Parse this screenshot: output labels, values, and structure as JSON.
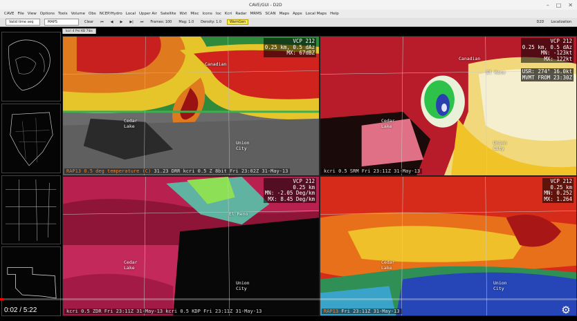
{
  "window": {
    "title": "CAVE/GUI - D2D"
  },
  "menubar": [
    "CAVE",
    "File",
    "View",
    "Options",
    "Tools",
    "Volume",
    "Obs",
    "NCEP/Hydro",
    "Local",
    "Upper Air",
    "Satellite",
    "Wxt",
    "Misc",
    "Icons",
    "Ioc",
    "Kcri",
    "Radar",
    "MRMS",
    "SCAN",
    "Maps",
    "Apps",
    "Local Maps",
    "Help"
  ],
  "toolbar": {
    "time_select": "Valid time seq",
    "proj": "MAPS",
    "clear": "Clear",
    "frames": "Frames: 100",
    "mag": "Mag: 1.0",
    "density": "Density: 1.0",
    "highlight": "WarnGen",
    "mode": "D2D",
    "localization": "Localization"
  },
  "tabs": [
    "kcri 4 Pnl KB 7lbs"
  ],
  "panels": [
    {
      "readout": [
        "VCP 212",
        "0.25 km, 0.5 dAz",
        "MX: 67dBZ"
      ],
      "extra": [],
      "status_prefix": "RAP13 0.5 deg temperature (C)",
      "status": "31.23  DRR  kcri 0.5  Z 8bit  Fri 23:02Z 31-May-13",
      "cities": {
        "a": "Canadian",
        "b": "Cedar\nLake",
        "c": "Union\nCity",
        "d": ""
      }
    },
    {
      "readout": [
        "VCP 212",
        "0.25 km, 0.5 dAz",
        "MN: -123kt",
        "MX: 122kt"
      ],
      "extra": [
        "USR:  274°  16.0kt",
        "MVMT FROM 23:30Z"
      ],
      "status_prefix": "",
      "status": "kcri 0.5  SRM  Fri 23:11Z 31-May-13",
      "cities": {
        "a": "Canadian",
        "b": "Cedar\nLake",
        "c": "Union\nCity",
        "d": "El Reno"
      }
    },
    {
      "readout": [
        "VCP 212",
        "0.25 km",
        "MN: -2.05 Deg/km",
        "MX: 8.45 Deg/km"
      ],
      "extra": [],
      "status_prefix": "",
      "status": "kcri 0.5  ZDR  Fri 23:11Z 31-May-13  kcri 0.5  KDP  Fri 23:11Z 31-May-13",
      "cities": {
        "a": "",
        "b": "Cedar\nLake",
        "c": "Union\nCity",
        "d": "El Reno"
      }
    },
    {
      "readout": [
        "VCP 212",
        "0.25 km",
        "MN: 0.252",
        "MX: 1.264"
      ],
      "extra": [],
      "status_prefix": "RAP13",
      "status": "Fri 23:11Z 31-May-13",
      "cities": {
        "a": "",
        "b": "Cedar\nLake",
        "c": "Union\nCity",
        "d": ""
      }
    }
  ],
  "video": {
    "time": "0:02 / 5:22",
    "progress": 0.006
  }
}
